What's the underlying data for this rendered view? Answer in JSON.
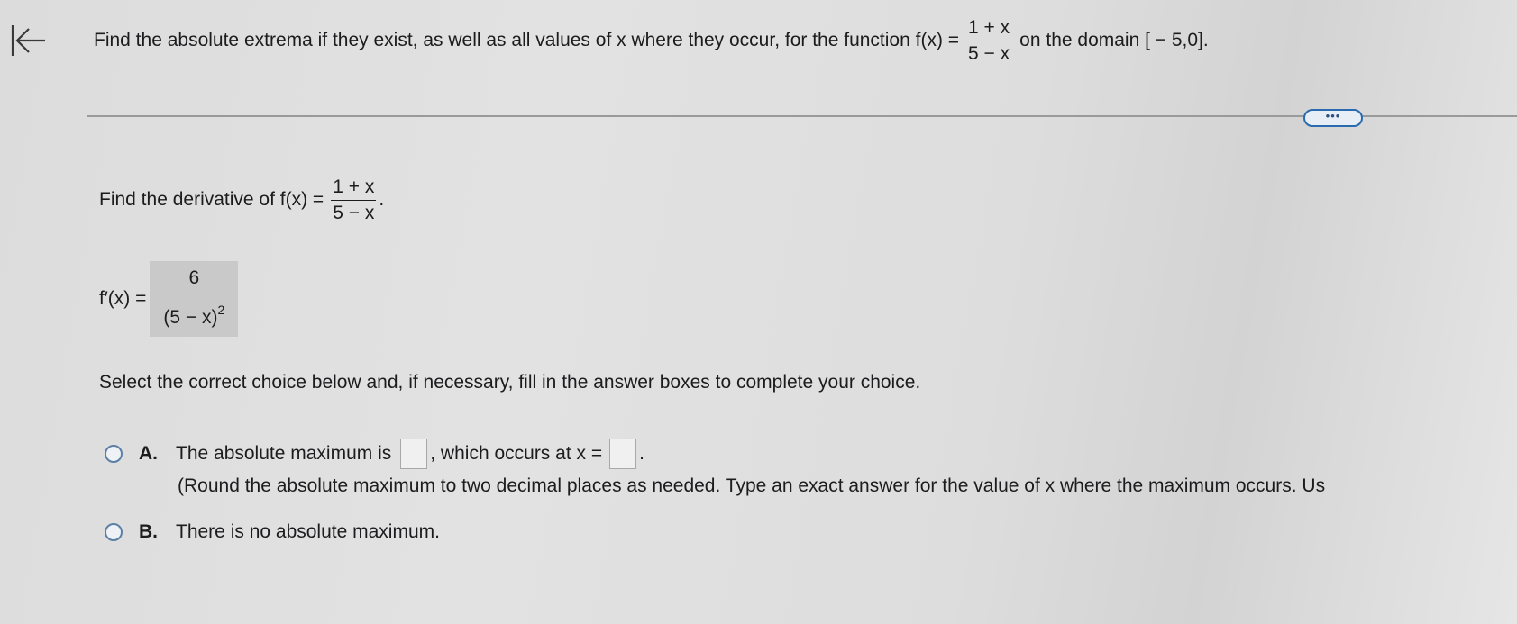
{
  "nav": {
    "back_icon": "collapse-left-icon"
  },
  "question": {
    "prefix": "Find the absolute extrema if they exist, as well as all values of x where they occur, for the function f(x) =",
    "numerator": "1 + x",
    "denominator": "5 − x",
    "suffix": "on the domain [ − 5,0]."
  },
  "more_button": {
    "label": "•••"
  },
  "step": {
    "prefix": "Find the derivative of f(x) =",
    "numerator": "1 + x",
    "denominator": "5 − x",
    "suffix": "."
  },
  "derivative": {
    "label": "f′(x) =",
    "numerator": "6",
    "denominator": "(5 − x)",
    "exponent": "2"
  },
  "instruction": "Select the correct choice below and, if necessary, fill in the answer boxes to complete your choice.",
  "choices": [
    {
      "letter": "A.",
      "text_1": "The absolute maximum is",
      "text_2": ", which occurs at x =",
      "text_3": ".",
      "note": "(Round the absolute maximum to two decimal places as needed. Type an exact answer for the value of x where the maximum occurs. Us"
    },
    {
      "letter": "B.",
      "text": "There is no absolute maximum."
    }
  ]
}
